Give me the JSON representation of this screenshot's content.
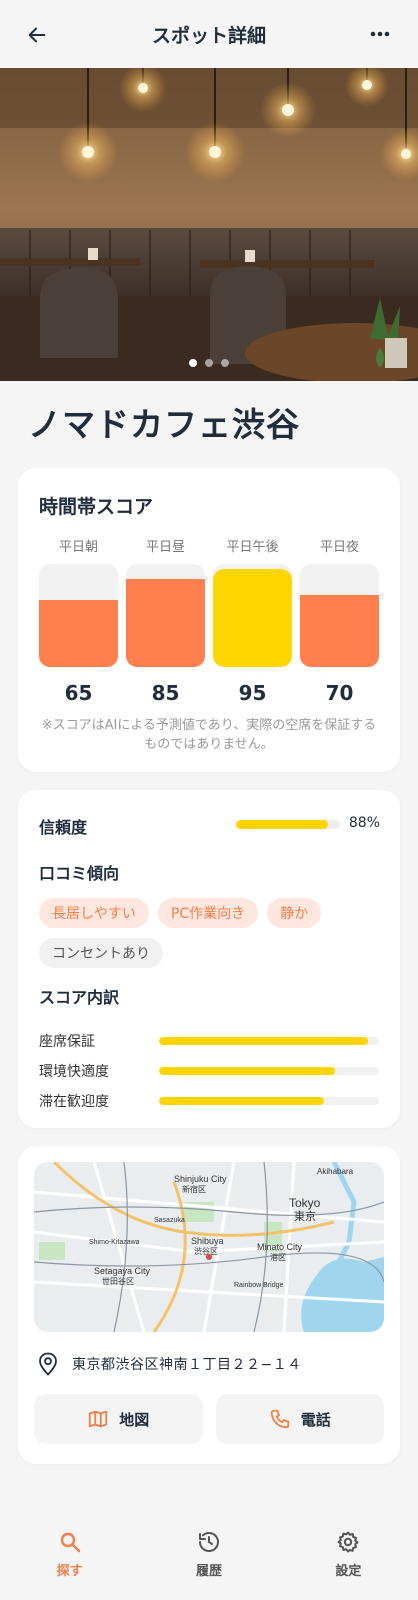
{
  "header": {
    "title": "スポット詳細"
  },
  "hero": {
    "image_count": 3,
    "active_index": 0
  },
  "spot": {
    "name": "ノマドカフェ渋谷"
  },
  "time_scores": {
    "title": "時間帯スコア",
    "slots": [
      {
        "label": "平日朝",
        "value": "65",
        "fill": 0.65,
        "color": "#ff7f4e"
      },
      {
        "label": "平日昼",
        "value": "85",
        "fill": 0.85,
        "color": "#ff7f4e"
      },
      {
        "label": "平日午後",
        "value": "95",
        "fill": 0.95,
        "color": "#ffd600"
      },
      {
        "label": "平日夜",
        "value": "70",
        "fill": 0.7,
        "color": "#ff7f4e"
      }
    ],
    "disclaimer": "※スコアはAIによる予測値であり、実際の空席を保証するものではありません。"
  },
  "trust": {
    "label": "信頼度",
    "value": "88%",
    "fill": 0.88
  },
  "reviews": {
    "title": "口コミ傾向",
    "tags": [
      {
        "label": "長居しやすい",
        "style": "orange"
      },
      {
        "label": "PC作業向き",
        "style": "orange"
      },
      {
        "label": "静か",
        "style": "orange"
      },
      {
        "label": "コンセントあり",
        "style": "gray"
      }
    ]
  },
  "breakdown": {
    "title": "スコア内訳",
    "items": [
      {
        "label": "座席保証",
        "fill": 0.95
      },
      {
        "label": "環境快適度",
        "fill": 0.8
      },
      {
        "label": "滞在歓迎度",
        "fill": 0.75
      }
    ]
  },
  "location": {
    "address": "東京都渋谷区神南１丁目２２−１４",
    "map_button": "地図",
    "phone_button": "電話",
    "map_labels": [
      "Shinjuku City",
      "新宿区",
      "Tokyo",
      "東京",
      "Shibuya",
      "渋谷区",
      "Minato City",
      "港区",
      "Setagaya City",
      "世田谷区",
      "Akihabara",
      "Sasazuka",
      "Shimo-Kitazawa",
      "Rainbow Bridge"
    ]
  },
  "tabs": [
    {
      "label": "探す",
      "icon": "search-icon",
      "active": true
    },
    {
      "label": "履歴",
      "icon": "history-icon",
      "active": false
    },
    {
      "label": "設定",
      "icon": "gear-icon",
      "active": false
    }
  ],
  "colors": {
    "accent": "#f07f4a",
    "yellow": "#ffd600",
    "orange": "#ff7f4e",
    "text": "#1f2d3d"
  }
}
